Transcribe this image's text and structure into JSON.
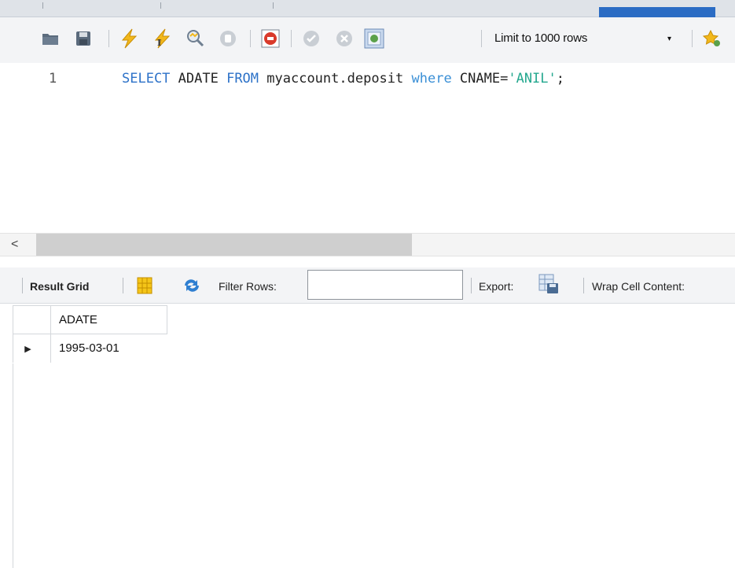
{
  "toolbar": {
    "limit_label": "Limit to 1000 rows",
    "limit_dropdown_arrow": "▾",
    "icons": [
      "open-folder-icon",
      "save-icon",
      "execute-icon",
      "execute-current-icon",
      "explain-icon",
      "stop-icon",
      "toggle-error-icon",
      "commit-icon",
      "rollback-icon",
      "autocommit-icon",
      "beautify-icon"
    ]
  },
  "editor": {
    "line_number": "1",
    "sql": {
      "kw_select": "SELECT",
      "col": " ADATE ",
      "kw_from": "FROM",
      "table": " myaccount.deposit ",
      "kw_where": "where",
      "cond": " CNAME=",
      "value": "'ANIL'",
      "end": ";"
    }
  },
  "scrollbar": {
    "left_arrow": "<"
  },
  "result_toolbar": {
    "result_grid_label": "Result Grid",
    "filter_label": "Filter Rows:",
    "filter_value": "",
    "export_label": "Export:",
    "wrap_label": "Wrap Cell Content:"
  },
  "grid": {
    "columns": [
      "ADATE"
    ],
    "rows": [
      [
        "1995-03-01"
      ]
    ],
    "row_marker": "▶"
  }
}
